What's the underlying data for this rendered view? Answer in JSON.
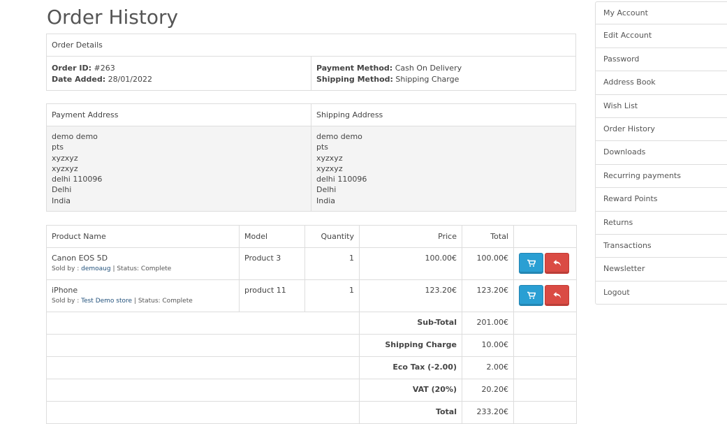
{
  "page_title": "Order History",
  "order_details": {
    "header": "Order Details",
    "order_id_label": "Order ID:",
    "order_id": "#263",
    "date_added_label": "Date Added:",
    "date_added": "28/01/2022",
    "payment_method_label": "Payment Method:",
    "payment_method": "Cash On Delivery",
    "shipping_method_label": "Shipping Method:",
    "shipping_method": "Shipping Charge"
  },
  "addresses": {
    "payment_header": "Payment Address",
    "shipping_header": "Shipping Address",
    "payment_lines": [
      "demo demo",
      "pts",
      "xyzxyz",
      "xyzxyz",
      "delhi 110096",
      "Delhi",
      "India"
    ],
    "shipping_lines": [
      "demo demo",
      "pts",
      "xyzxyz",
      "xyzxyz",
      "delhi 110096",
      "Delhi",
      "India"
    ]
  },
  "products": {
    "columns": [
      "Product Name",
      "Model",
      "Quantity",
      "Price",
      "Total"
    ],
    "rows": [
      {
        "name": "Canon EOS 5D",
        "sold_by_label": "Sold by :",
        "seller": "demoaug",
        "status": "| Status: Complete",
        "model": "Product 3",
        "quantity": "1",
        "price": "100.00€",
        "total": "100.00€"
      },
      {
        "name": "iPhone",
        "sold_by_label": "Sold by :",
        "seller": "Test Demo store",
        "status": "| Status: Complete",
        "model": "product 11",
        "quantity": "1",
        "price": "123.20€",
        "total": "123.20€"
      }
    ],
    "totals": [
      {
        "label": "Sub-Total",
        "value": "201.00€"
      },
      {
        "label": "Shipping Charge",
        "value": "10.00€"
      },
      {
        "label": "Eco Tax (-2.00)",
        "value": "2.00€"
      },
      {
        "label": "VAT (20%)",
        "value": "20.20€"
      },
      {
        "label": "Total",
        "value": "233.20€"
      }
    ]
  },
  "icons": {
    "reorder": "cart-icon",
    "return": "reply-icon"
  },
  "colors": {
    "reorder_button": "#2a9fd3",
    "return_button": "#da4b44",
    "link": "#23527c"
  },
  "sidebar": {
    "items": [
      "My Account",
      "Edit Account",
      "Password",
      "Address Book",
      "Wish List",
      "Order History",
      "Downloads",
      "Recurring payments",
      "Reward Points",
      "Returns",
      "Transactions",
      "Newsletter",
      "Logout"
    ]
  }
}
